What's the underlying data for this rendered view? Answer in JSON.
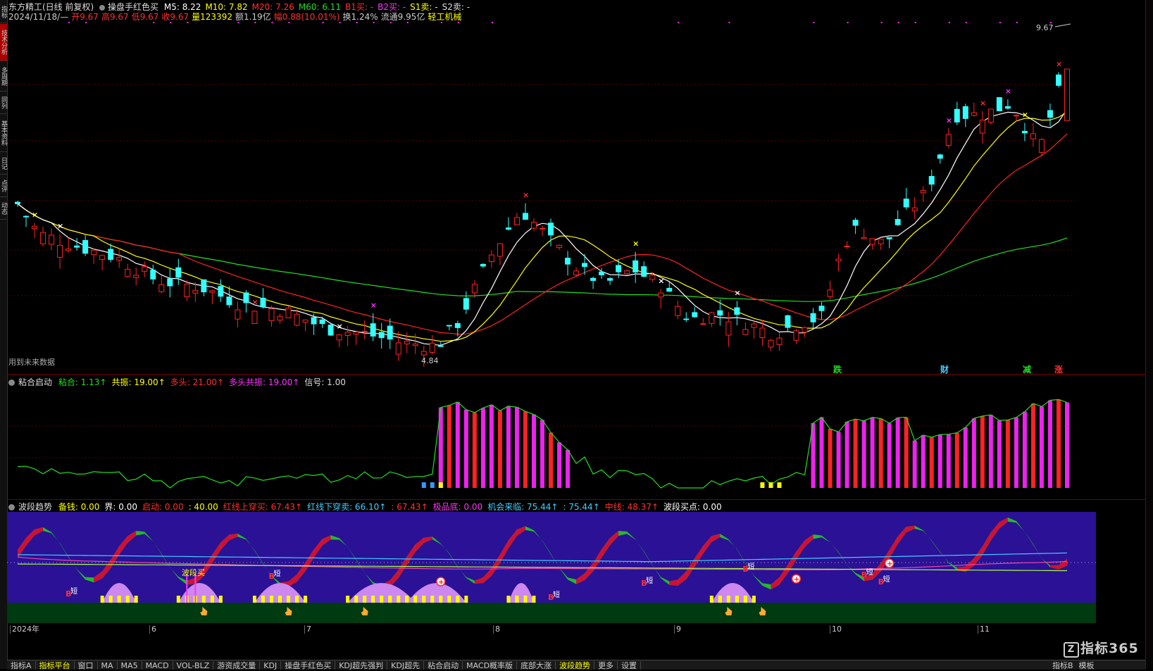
{
  "header": {
    "stock_name": "东方精工(日线 前复权)",
    "formula_name": "操盘手红色买",
    "ma_labels": [
      {
        "text": "M5: 8.22",
        "color": "#ffffff"
      },
      {
        "text": "M10: 7.82",
        "color": "#ffff00"
      },
      {
        "text": "M20: 7.26",
        "color": "#ff3030"
      },
      {
        "text": "M60: 6.11",
        "color": "#22dd22"
      },
      {
        "text": "B1买: -",
        "color": "#ff3030"
      },
      {
        "text": "B2买: -",
        "color": "#ff33ff"
      },
      {
        "text": "S1卖: -",
        "color": "#ffff00"
      },
      {
        "text": "S2卖: -",
        "color": "#dddddd"
      }
    ],
    "quote_line": [
      {
        "text": "2024/11/18/—",
        "color": "#cccccc"
      },
      {
        "text": "开9.67",
        "color": "#ff3030"
      },
      {
        "text": "高9.67",
        "color": "#ff3030"
      },
      {
        "text": "低9.67",
        "color": "#ff3030"
      },
      {
        "text": "收9.67",
        "color": "#ff3030"
      },
      {
        "text": "量123392",
        "color": "#ffff00"
      },
      {
        "text": "额1.19亿",
        "color": "#cccccc"
      },
      {
        "text": "幅0.88(10.01%)",
        "color": "#ff3030"
      },
      {
        "text": "换1.24%",
        "color": "#cccccc"
      },
      {
        "text": "流通9.95亿",
        "color": "#cccccc"
      },
      {
        "text": "轻工机械",
        "color": "#ffff00"
      }
    ]
  },
  "left_tabs": [
    "指标",
    "技术分析",
    "多周期",
    "同列",
    "基本资料",
    "日记",
    "点评",
    "动态"
  ],
  "price_panel": {
    "high_label": "9.67",
    "low_label": "4.84",
    "note": "用到未来数据",
    "signals": [
      {
        "text": "跌",
        "color": "#22dd22"
      },
      {
        "text": "财",
        "color": "#44ccff"
      },
      {
        "text": "减",
        "color": "#22dd22"
      },
      {
        "text": "涨",
        "color": "#ff3030"
      }
    ]
  },
  "indicator1": {
    "name": "粘合启动",
    "values": [
      {
        "text": "粘合: 1.13↑",
        "color": "#22dd22"
      },
      {
        "text": "共振: 19.00↑",
        "color": "#ffff00"
      },
      {
        "text": "多头: 21.00↑",
        "color": "#ff3030"
      },
      {
        "text": "多头共振: 19.00↑",
        "color": "#ff33ff"
      },
      {
        "text": "信号: 1.00",
        "color": "#dddddd"
      }
    ]
  },
  "indicator2": {
    "name": "波段趋势",
    "values": [
      {
        "text": "备钱: 0.00",
        "color": "#ffff00"
      },
      {
        "text": "界: 0.00",
        "color": "#ffffff"
      },
      {
        "text": "启动: 0.00",
        "color": "#ff3030"
      },
      {
        "text": ": 40.00",
        "color": "#ffff00"
      },
      {
        "text": "红线上穿买: 67.43↑",
        "color": "#ff3030"
      },
      {
        "text": "红线下穿卖: 66.10↑",
        "color": "#44ccff"
      },
      {
        "text": ": 67.43↑",
        "color": "#ff3030"
      },
      {
        "text": "极品底: 0.00",
        "color": "#ff33ff"
      },
      {
        "text": "机会来临: 75.44↑",
        "color": "#44ccff"
      },
      {
        "text": ": 75.44↑",
        "color": "#44ccff"
      },
      {
        "text": "中线: 48.37↑",
        "color": "#ff3030"
      },
      {
        "text": "波段买点: 0.00",
        "color": "#ffffff"
      }
    ],
    "wave_label": "波段买",
    "short_label": "短",
    "b_label": "B"
  },
  "time_axis": [
    "2024年",
    "6",
    "7",
    "8",
    "9",
    "10",
    "11"
  ],
  "bottom_tabs": [
    "指标A",
    "指标平台",
    "窗口",
    "MA",
    "MA5",
    "MACD",
    "VOL-BLZ",
    "游资成交量",
    "KDJ",
    "操盘手红色买",
    "KDJ超先强判",
    "KDJ超先",
    "粘合启动",
    "MACD概率版",
    "底部大涨",
    "波段趋势",
    "更多",
    "设置"
  ],
  "bottom_right_tabs": [
    "指标B",
    "模板"
  ],
  "logo_text": "指标365",
  "chart_data": {
    "type": "candlestick",
    "title": "东方精工(日线 前复权)",
    "x_range": [
      "2024-05",
      "2024-11-18"
    ],
    "y_range": [
      4.84,
      9.67
    ],
    "axis_months": [
      "2024年",
      "6",
      "7",
      "8",
      "9",
      "10",
      "11"
    ],
    "last_bar": {
      "date": "2024/11/18",
      "open": 9.67,
      "high": 9.67,
      "low": 9.67,
      "close": 9.67,
      "volume": 123392,
      "change": 0.88,
      "change_pct": 10.01
    },
    "moving_averages": {
      "M5": 8.22,
      "M10": 7.82,
      "M20": 7.26,
      "M60": 6.11
    },
    "extremes": {
      "high": 9.67,
      "low": 4.84
    }
  }
}
